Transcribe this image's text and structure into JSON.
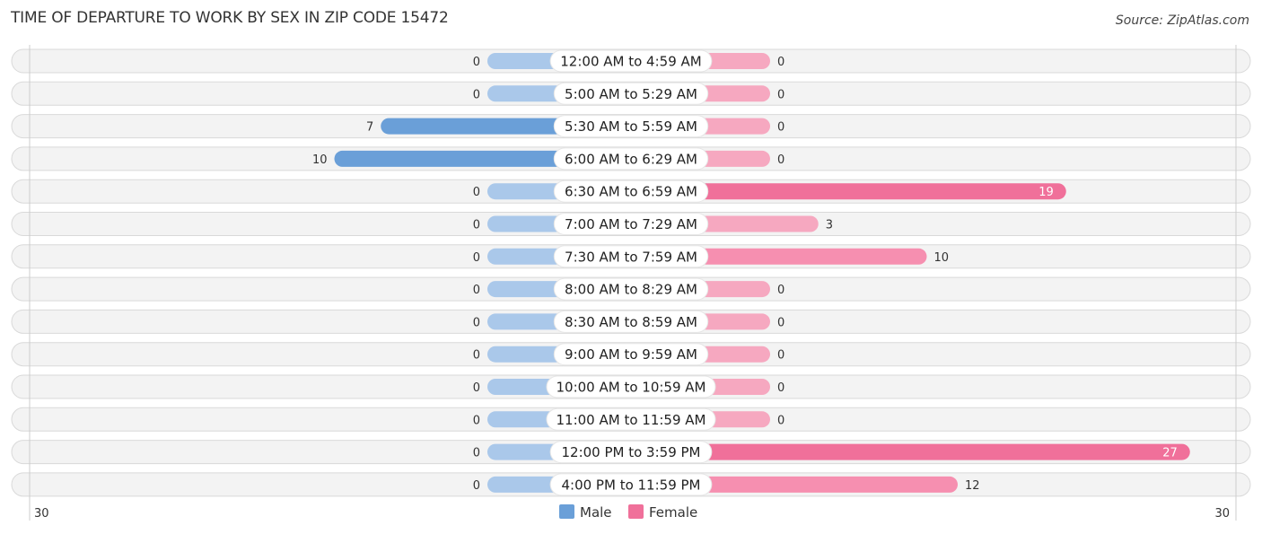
{
  "title": "TIME OF DEPARTURE TO WORK BY SEX IN ZIP CODE 15472",
  "source": "Source: ZipAtlas.com",
  "colors": {
    "male_strong": "#6a9fd8",
    "male_light": "#aac8ea",
    "female_strong": "#f0709a",
    "female_light": "#f6a8c0"
  },
  "chart_data": {
    "type": "bar",
    "orientation": "horizontal-butterfly",
    "title": "TIME OF DEPARTURE TO WORK BY SEX IN ZIP CODE 15472",
    "categories": [
      "12:00 AM to 4:59 AM",
      "5:00 AM to 5:29 AM",
      "5:30 AM to 5:59 AM",
      "6:00 AM to 6:29 AM",
      "6:30 AM to 6:59 AM",
      "7:00 AM to 7:29 AM",
      "7:30 AM to 7:59 AM",
      "8:00 AM to 8:29 AM",
      "8:30 AM to 8:59 AM",
      "9:00 AM to 9:59 AM",
      "10:00 AM to 10:59 AM",
      "11:00 AM to 11:59 AM",
      "12:00 PM to 3:59 PM",
      "4:00 PM to 11:59 PM"
    ],
    "series": [
      {
        "name": "Male",
        "values": [
          0,
          0,
          7,
          10,
          0,
          0,
          0,
          0,
          0,
          0,
          0,
          0,
          0,
          0
        ]
      },
      {
        "name": "Female",
        "values": [
          0,
          0,
          0,
          0,
          19,
          3,
          10,
          0,
          0,
          0,
          0,
          0,
          27,
          12
        ]
      }
    ],
    "axis": {
      "left_label": "30",
      "right_label": "30",
      "max": 30
    },
    "legend": {
      "position": "bottom-center",
      "items": [
        "Male",
        "Female"
      ]
    },
    "grid": false
  }
}
